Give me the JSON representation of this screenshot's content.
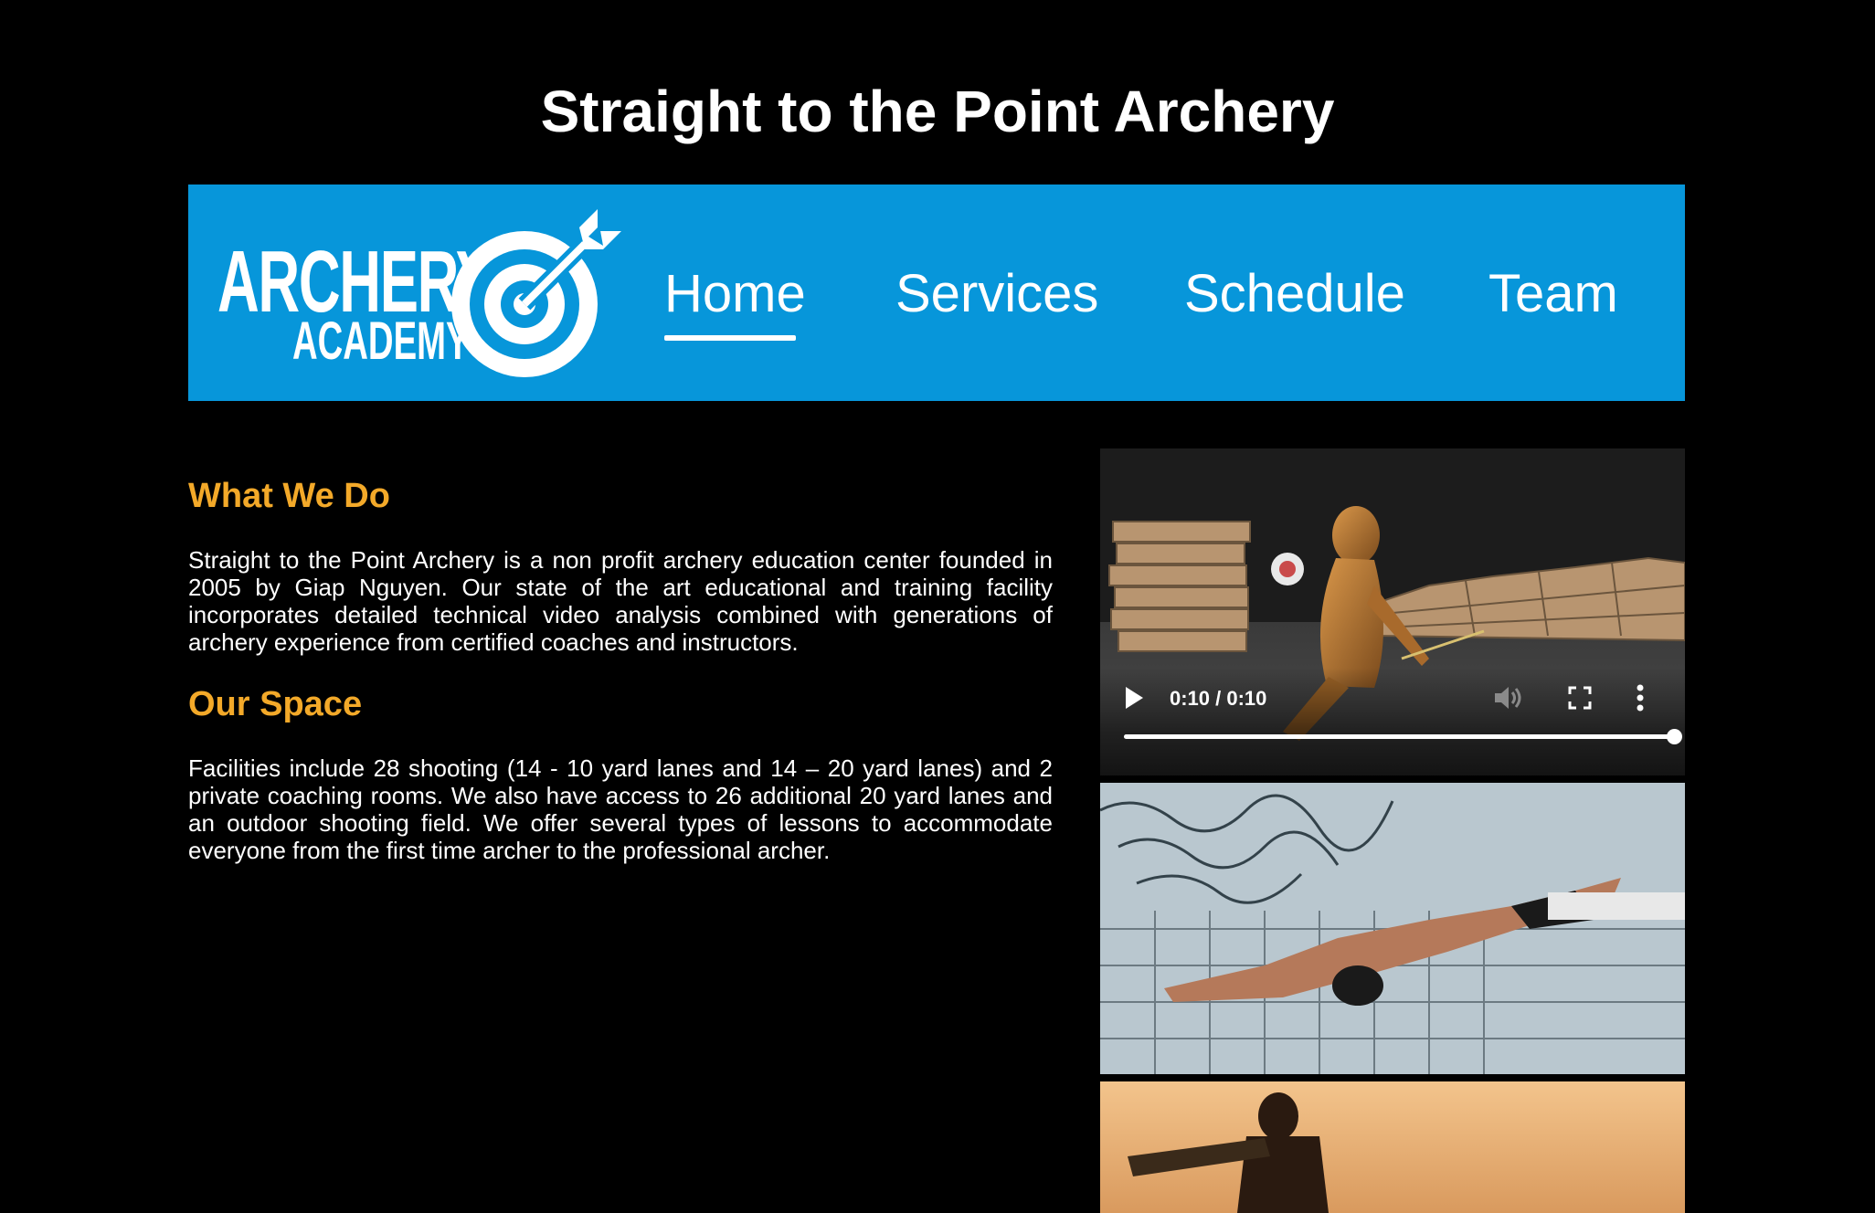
{
  "site": {
    "title": "Straight to the Point Archery"
  },
  "logo": {
    "line1": "ARCHERY",
    "line2": "ACADEMY",
    "icon": "target-arrow-icon"
  },
  "nav": {
    "items": [
      {
        "label": "Home",
        "active": true
      },
      {
        "label": "Services",
        "active": false
      },
      {
        "label": "Schedule",
        "active": false
      },
      {
        "label": "Team",
        "active": false
      }
    ]
  },
  "sections": {
    "what_we_do": {
      "heading": "What We Do",
      "text": "Straight to the Point Archery is a non profit archery education center founded in 2005 by Giap Nguyen. Our state of the art educational and training facility incorporates detailed technical video analysis combined with generations of archery experience from certified coaches and instructors."
    },
    "our_space": {
      "heading": "Our Space",
      "text": "Facilities include 28 shooting (14 - 10 yard lanes and 14 – 20 yard lanes) and 2 private coaching rooms. We also have access to 26 additional 20 yard lanes and an outdoor shooting field. We offer several types of lessons to accommodate everyone from the first time archer to the professional archer."
    }
  },
  "video": {
    "time": "0:10 / 0:10",
    "progress_fraction": 1.0,
    "icons": {
      "play": "play-icon",
      "mute": "volume-icon",
      "fullscreen": "fullscreen-icon",
      "more": "more-vertical-icon"
    }
  },
  "colors": {
    "background": "#000000",
    "nav_background": "#0796da",
    "heading_accent": "#f3a929",
    "text": "#ffffff"
  }
}
